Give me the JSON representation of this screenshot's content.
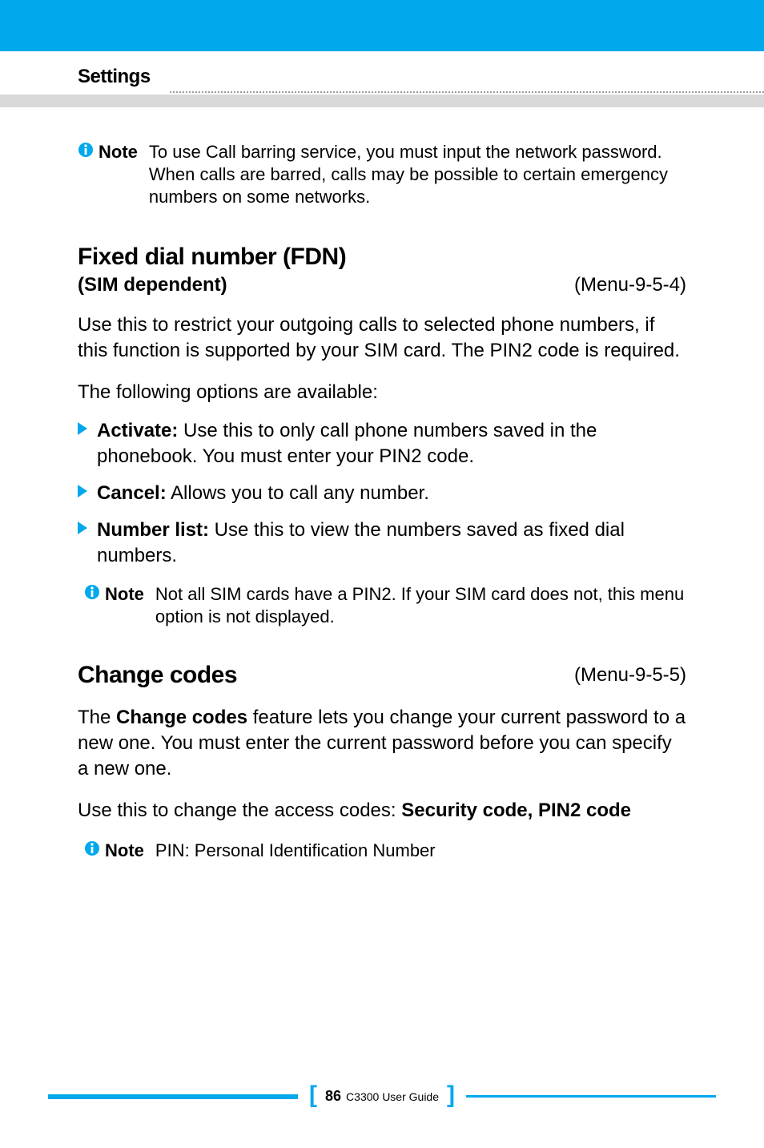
{
  "header": {
    "title": "Settings"
  },
  "note1": {
    "label": "Note",
    "text": "To use Call barring service, you must input the network password. When calls are barred, calls may be possible to certain emergency numbers on some networks."
  },
  "section_fdn": {
    "heading": "Fixed dial number (FDN)",
    "subheading": "(SIM dependent)",
    "menu_ref": "(Menu-9-5-4)",
    "para1": "Use this to restrict your outgoing calls to selected phone numbers, if this function is supported by your SIM card. The PIN2 code is required.",
    "para2": "The following options are available:",
    "bullets": [
      {
        "label": "Activate:",
        "text": " Use this to only call phone numbers saved in the phonebook. You must enter your PIN2 code."
      },
      {
        "label": "Cancel:",
        "text": " Allows you to call any number."
      },
      {
        "label": "Number list:",
        "text": " Use this to view the numbers saved as fixed dial numbers."
      }
    ],
    "note": {
      "label": "Note",
      "text": "Not all SIM cards have a PIN2. If your SIM card does not, this menu option is not displayed."
    }
  },
  "section_codes": {
    "heading": "Change codes",
    "menu_ref": "(Menu-9-5-5)",
    "para1_pre": "The ",
    "para1_bold": "Change codes",
    "para1_post": " feature lets you change your current password to a new one. You must enter the current password before you can specify a new one.",
    "para2_pre": "Use this to change the access codes: ",
    "para2_bold": "Security code, PIN2 code",
    "note": {
      "label": "Note",
      "text": "PIN: Personal Identification Number"
    }
  },
  "footer": {
    "page_number": "86",
    "guide": "C3300 User Guide"
  }
}
